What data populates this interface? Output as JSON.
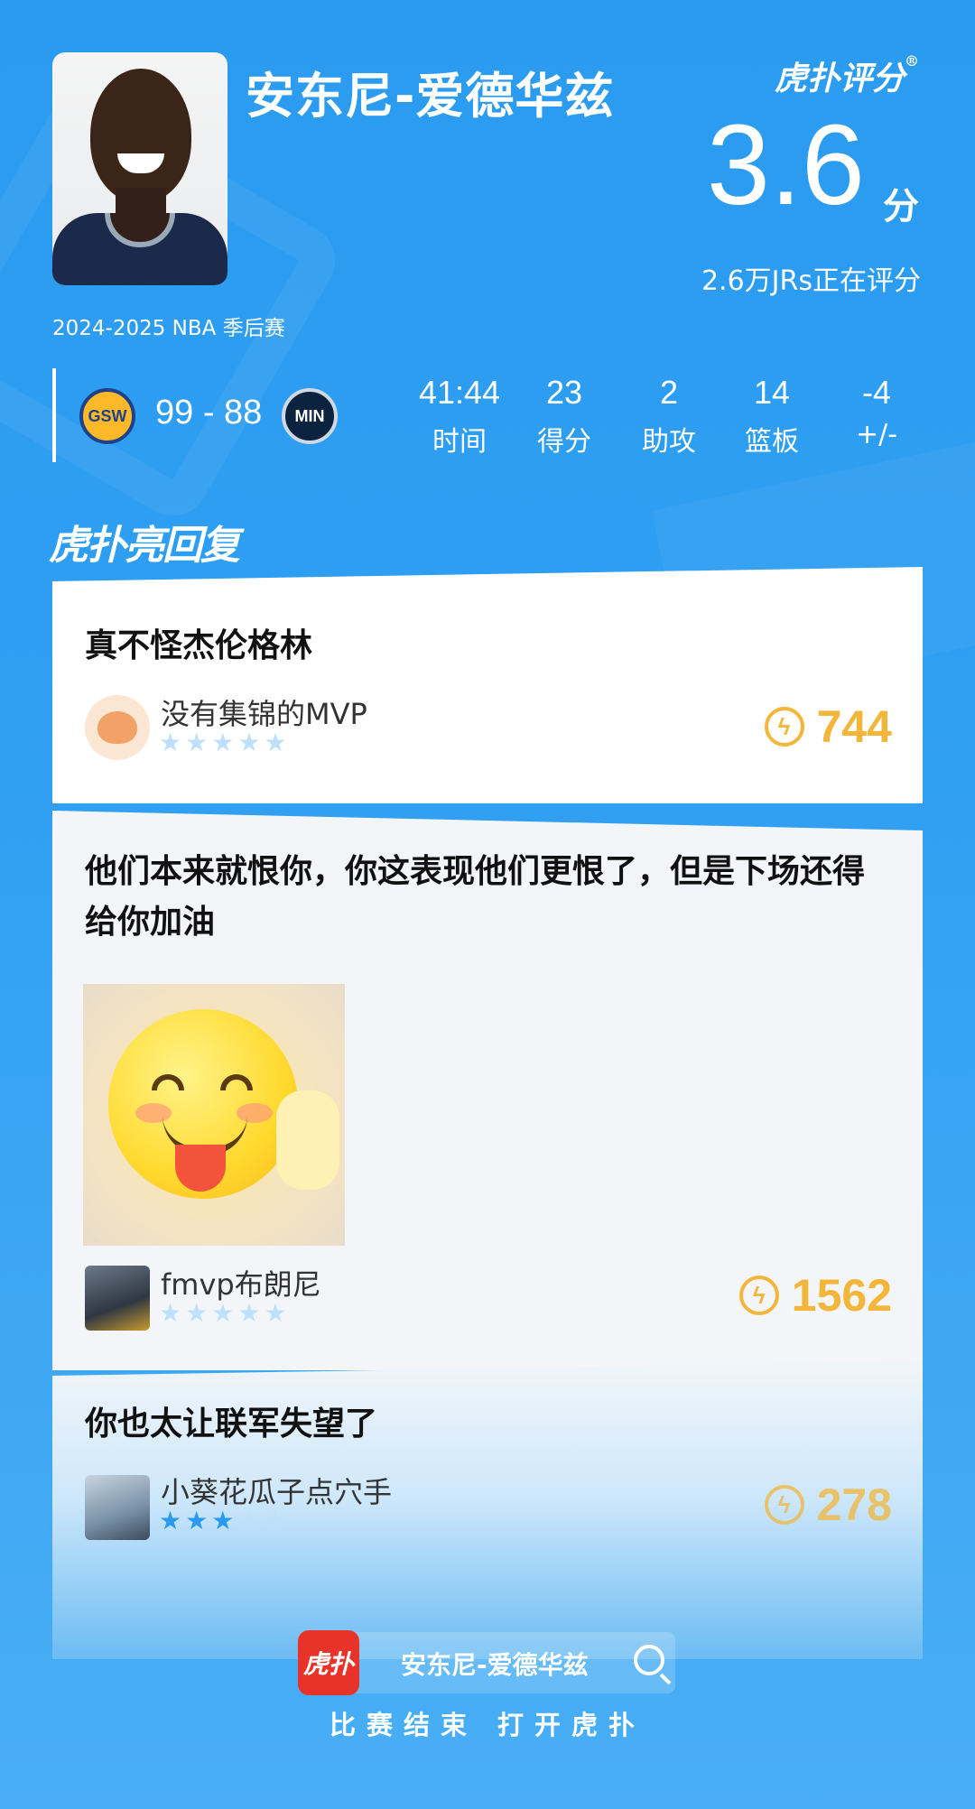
{
  "header": {
    "player_name": "安东尼-爱德华兹",
    "brand": "虎扑评分",
    "brand_mark": "®",
    "score": "3.6",
    "score_unit": "分",
    "raters": "2.6万JRs正在评分",
    "season": "2024-2025 NBA 季后赛"
  },
  "game": {
    "home_team": "GSW",
    "away_team": "MIN",
    "score": "99 - 88",
    "stats": [
      {
        "value": "41:44",
        "label": "时间"
      },
      {
        "value": "23",
        "label": "得分"
      },
      {
        "value": "2",
        "label": "助攻"
      },
      {
        "value": "14",
        "label": "篮板"
      },
      {
        "value": "-4",
        "label": "+/-"
      }
    ]
  },
  "section_title": "虎扑亮回复",
  "comments": [
    {
      "text": "真不怪杰伦格林",
      "user": "没有集锦的MVP",
      "stars": 0,
      "likes": "744"
    },
    {
      "text": "他们本来就恨你，你这表现他们更恨了，但是下场还得给你加油",
      "user": "fmvp布朗尼",
      "stars": 0,
      "likes": "1562"
    },
    {
      "text": "你也太让联军失望了",
      "user": "小葵花瓜子点穴手",
      "stars": 3,
      "likes": "278"
    }
  ],
  "footer": {
    "app_icon_text": "虎扑",
    "search_text": "安东尼-爱德华兹",
    "caption": "比赛结束 打开虎扑"
  },
  "colors": {
    "background": "#2f9ff2",
    "accent": "#2a9af0",
    "likes": "#f3b63a"
  }
}
